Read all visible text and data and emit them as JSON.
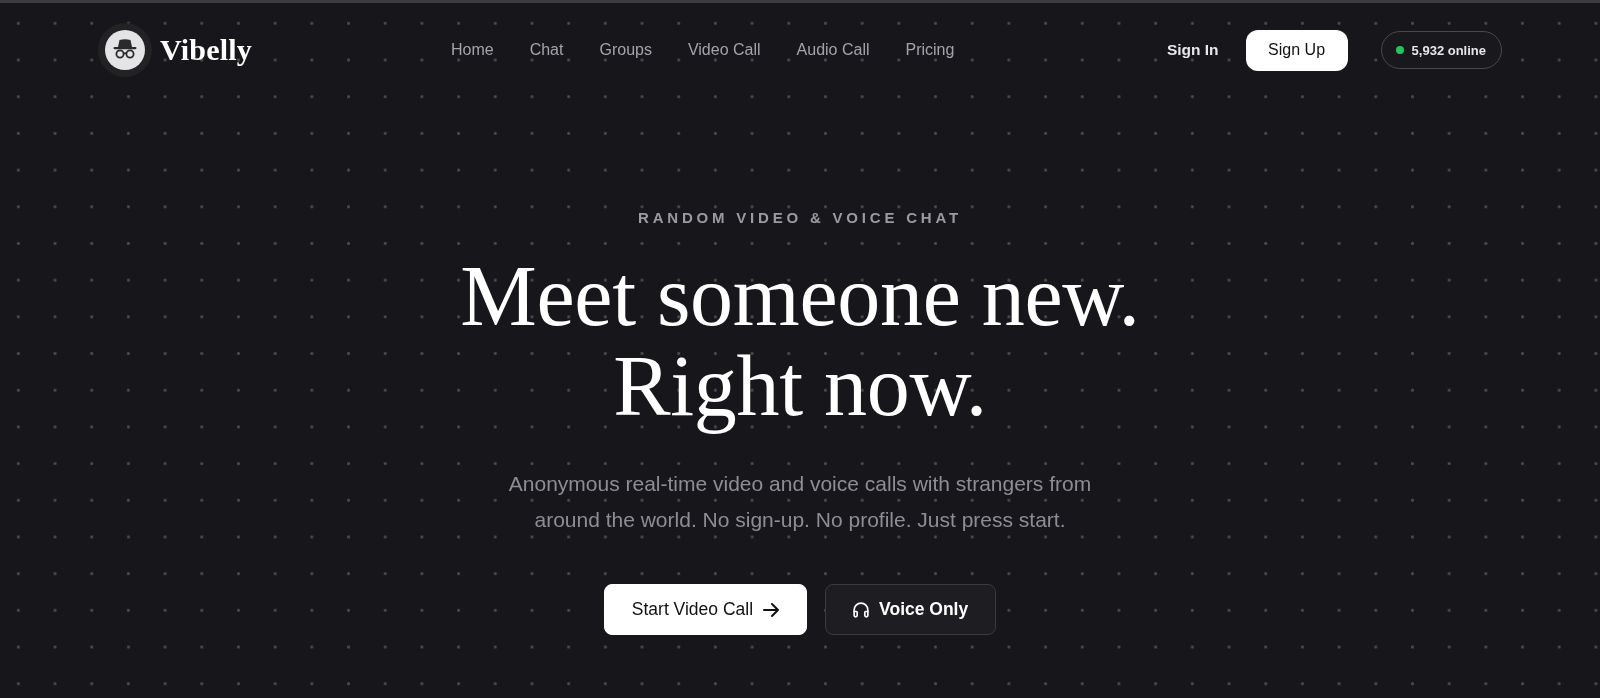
{
  "brand": {
    "name": "Vibelly"
  },
  "nav": {
    "links": [
      {
        "label": "Home"
      },
      {
        "label": "Chat"
      },
      {
        "label": "Groups"
      },
      {
        "label": "Video Call"
      },
      {
        "label": "Audio Call"
      },
      {
        "label": "Pricing"
      }
    ]
  },
  "auth": {
    "sign_in": "Sign In",
    "sign_up": "Sign Up"
  },
  "online": {
    "count": "5,932 online"
  },
  "hero": {
    "eyebrow": "RANDOM VIDEO & VOICE CHAT",
    "headline": [
      "Meet someone new.",
      "Right now."
    ],
    "subtitle": "Anonymous real-time video and voice calls with strangers from around the world. No sign-up. No profile. Just press start.",
    "actions": [
      {
        "label": "Start Video Call",
        "kind": "primary"
      },
      {
        "label": "Voice Only",
        "kind": "secondary"
      }
    ]
  }
}
